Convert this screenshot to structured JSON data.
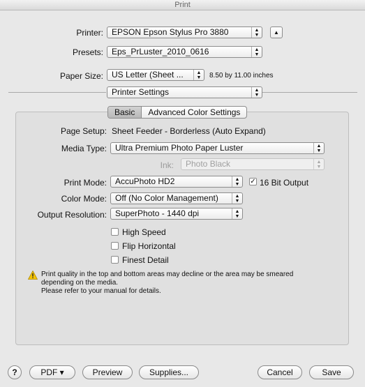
{
  "window": {
    "title": "Print"
  },
  "printer": {
    "label": "Printer:",
    "value": "EPSON Epson Stylus Pro 3880"
  },
  "presets": {
    "label": "Presets:",
    "value": "Eps_PrLuster_2010_0616"
  },
  "paper_size": {
    "label": "Paper Size:",
    "value": "US Letter (Sheet ...",
    "dimensions": "8.50 by 11.00 inches"
  },
  "section_popup": {
    "value": "Printer Settings"
  },
  "tabs": [
    {
      "label": "Basic",
      "selected": true
    },
    {
      "label": "Advanced Color Settings",
      "selected": false
    }
  ],
  "settings": {
    "page_setup_label": "Page Setup:",
    "page_setup_value": "Sheet Feeder - Borderless (Auto Expand)",
    "media_type_label": "Media Type:",
    "media_type_value": "Ultra Premium Photo Paper Luster",
    "ink_label": "Ink:",
    "ink_value": "Photo Black",
    "print_mode_label": "Print Mode:",
    "print_mode_value": "AccuPhoto HD2",
    "bit16_label": "16 Bit Output",
    "bit16_checked": true,
    "color_mode_label": "Color Mode:",
    "color_mode_value": "Off (No Color Management)",
    "output_res_label": "Output Resolution:",
    "output_res_value": "SuperPhoto - 1440 dpi",
    "high_speed_label": "High Speed",
    "flip_label": "Flip Horizontal",
    "finest_label": "Finest Detail"
  },
  "warning": {
    "icon": "warning-triangle-icon",
    "line1": "Print quality in the top and bottom areas may decline or the area may be smeared",
    "line2": "depending on the media.",
    "line3": "Please refer to your manual for details."
  },
  "footer": {
    "help": "?",
    "pdf": "PDF ▾",
    "preview": "Preview",
    "supplies": "Supplies...",
    "cancel": "Cancel",
    "save": "Save"
  },
  "colors": {
    "window_bg": "#e8e8e8",
    "panel_bg": "#e0e0e0",
    "warning": "#f5c400"
  }
}
